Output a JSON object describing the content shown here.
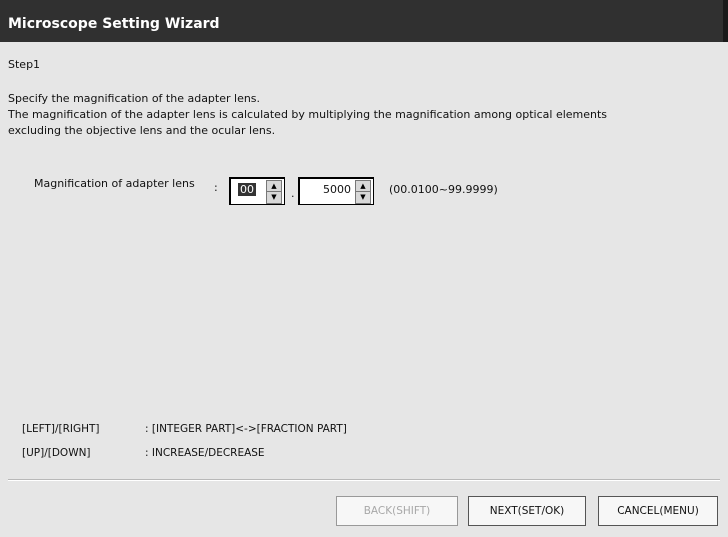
{
  "window": {
    "title": "Microscope Setting Wizard"
  },
  "step": {
    "label": "Step1"
  },
  "description": {
    "line1": "Specify the magnification of the adapter lens.",
    "line2": "The magnification of the adapter lens is calculated by multiplying the magnification among optical elements",
    "line3": "excluding the objective lens and the ocular lens."
  },
  "magnification": {
    "label": "Magnification of adapter lens",
    "colon": ":",
    "integer_value": "00",
    "separator": ".",
    "fraction_value": "5000",
    "range": "(00.0100~99.9999)"
  },
  "keys": [
    {
      "key": "[LEFT]/[RIGHT]",
      "desc": ": [INTEGER PART]<->[FRACTION PART]"
    },
    {
      "key": "[UP]/[DOWN]",
      "desc": ": INCREASE/DECREASE"
    }
  ],
  "buttons": {
    "back": "BACK(SHIFT)",
    "next": "NEXT(SET/OK)",
    "cancel": "CANCEL(MENU)"
  },
  "icons": {
    "spin_up": "up-arrow-icon",
    "spin_down": "down-arrow-icon"
  }
}
